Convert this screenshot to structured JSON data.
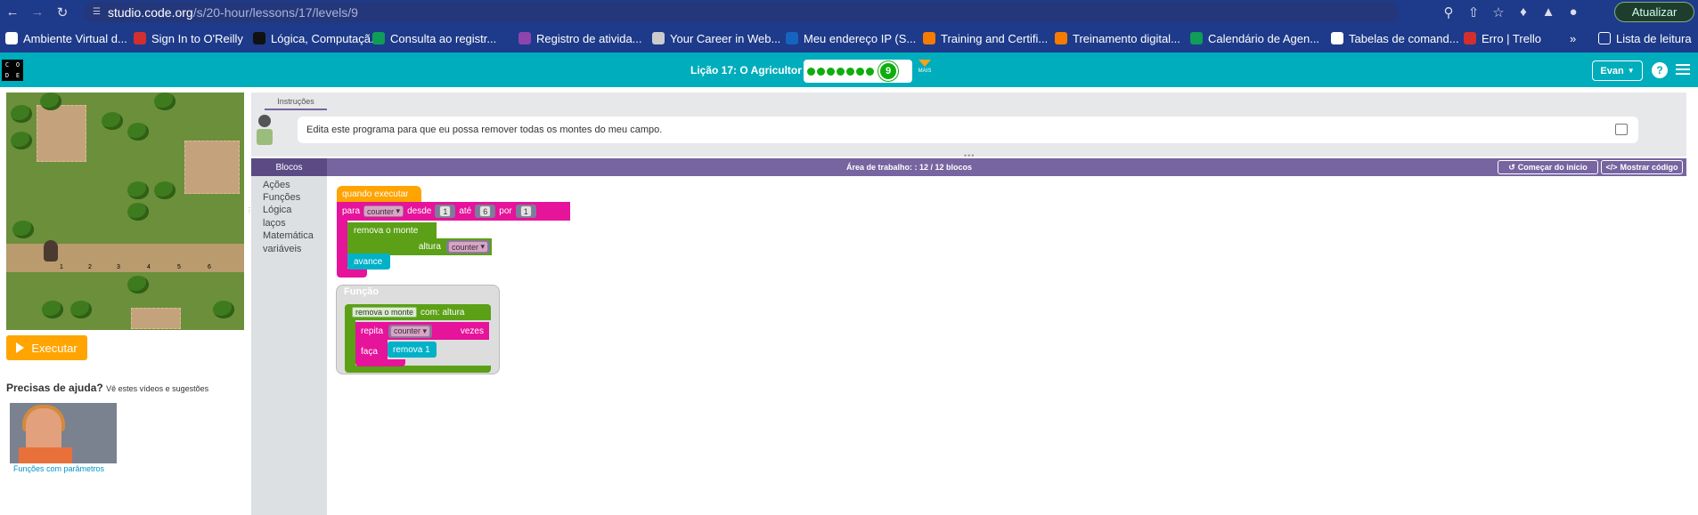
{
  "browser": {
    "url_host": "studio.code.org",
    "url_path": "/s/20-hour/lessons/17/levels/9",
    "update_label": "Atualizar",
    "bookmarks": [
      {
        "label": "Ambiente Virtual d...",
        "color": "#ffffff"
      },
      {
        "label": "Sign In to O'Reilly",
        "color": "#d32f2f"
      },
      {
        "label": "Lógica, Computaçã...",
        "color": "#111111"
      },
      {
        "label": "Consulta ao registr...",
        "color": "#0f9d58"
      },
      {
        "label": "Registro de ativida...",
        "color": "#8e44ad"
      },
      {
        "label": "Your Career in Web...",
        "color": "#cccccc"
      },
      {
        "label": "Meu endereço IP (S...",
        "color": "#1565c0"
      },
      {
        "label": "Training and Certifi...",
        "color": "#f57c00"
      },
      {
        "label": "Treinamento digital...",
        "color": "#f57c00"
      },
      {
        "label": "Calendário de Agen...",
        "color": "#0f9d58"
      },
      {
        "label": "Tabelas de comand...",
        "color": "#ffffff"
      },
      {
        "label": "Erro | Trello",
        "color": "#d32f2f"
      }
    ],
    "more_label": "»",
    "reading_list": "Lista de leitura"
  },
  "header": {
    "logo_letters": [
      "C",
      "O",
      "D",
      "E"
    ],
    "lesson_title": "Lição 17: O Agricultor 3",
    "current_level": "9",
    "progress_dots": 7,
    "more_label": "MAIS",
    "user_name": "Evan",
    "help": "?"
  },
  "game": {
    "numbers": [
      "1",
      "2",
      "3",
      "4",
      "5",
      "6"
    ],
    "run_label": "Executar"
  },
  "help": {
    "title": "Precisas de ajuda?",
    "subtitle": "Vê estes vídeos e sugestões",
    "video_label": "Funções com parâmetros"
  },
  "instructions": {
    "tab_label": "Instruções",
    "text": "Edita este programa para que eu possa remover todas os montes do meu campo."
  },
  "workspace": {
    "toolbox_title": "Blocos",
    "title": "Área de trabalho: : 12 / 12 blocos",
    "restart_label": "Começar do início",
    "show_code_label": "Mostrar código",
    "categories": [
      "Ações",
      "Funções",
      "Lógica",
      "laços",
      "Matemática",
      "variáveis"
    ]
  },
  "blocks": {
    "when_run": "quando executar",
    "for_for": "para",
    "for_var": "counter",
    "for_from": "desde",
    "for_from_val": "1",
    "for_to": "até",
    "for_to_val": "6",
    "for_by": "por",
    "for_by_val": "1",
    "remove_call": "remova o monte",
    "remove_param": "altura",
    "remove_arg": "counter",
    "forward": "avance",
    "func_label": "Função",
    "func_name": "remova o monte",
    "func_with": "com: altura",
    "repeat": "repita",
    "repeat_arg": "counter",
    "repeat_times": "vezes",
    "do": "faça",
    "remove_one": "remova 1"
  },
  "colors": {
    "browser_bar": "#1e3a8a",
    "codeorg_teal": "#00adbc",
    "workspace_purple": "#7665a0",
    "block_orange": "#ffa400",
    "block_pink": "#e6139b",
    "block_green": "#5ba016",
    "block_cyan": "#00b1c8"
  }
}
